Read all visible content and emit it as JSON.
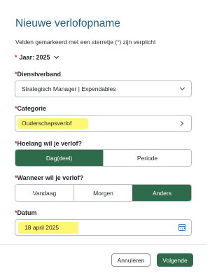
{
  "form": {
    "title": "Nieuwe verlofopname",
    "required_note_before": "Velden gemarkeerd met een sterretje (",
    "required_note_star": "*",
    "required_note_after": ") zijn verplicht",
    "star": "*",
    "year_label": "Jaar: 2025"
  },
  "fields": {
    "dienstverband": {
      "label": "Dienstverband",
      "value": "Strategisch Manager | Expendables"
    },
    "categorie": {
      "label": "Categorie",
      "value": "Ouderschapsverlof"
    },
    "hoelang": {
      "label": "Hoelang wil je verlof?",
      "options": [
        "Dag(deel)",
        "Periode"
      ],
      "selected": "Dag(deel)"
    },
    "wanneer": {
      "label": "Wanneer wil je verlof?",
      "options": [
        "Vandaag",
        "Morgen",
        "Anders"
      ],
      "selected": "Anders"
    },
    "datum": {
      "label": "Datum",
      "value": "18 april 2025"
    }
  },
  "actions": {
    "cancel_label": "Annuleren",
    "next_label": "Volgende"
  },
  "colors": {
    "title": "#1c5f8a",
    "required": "#d02a2a",
    "primary": "#2e6b4a",
    "highlight": "#fff66a",
    "calendar_icon": "#3a78b5"
  }
}
